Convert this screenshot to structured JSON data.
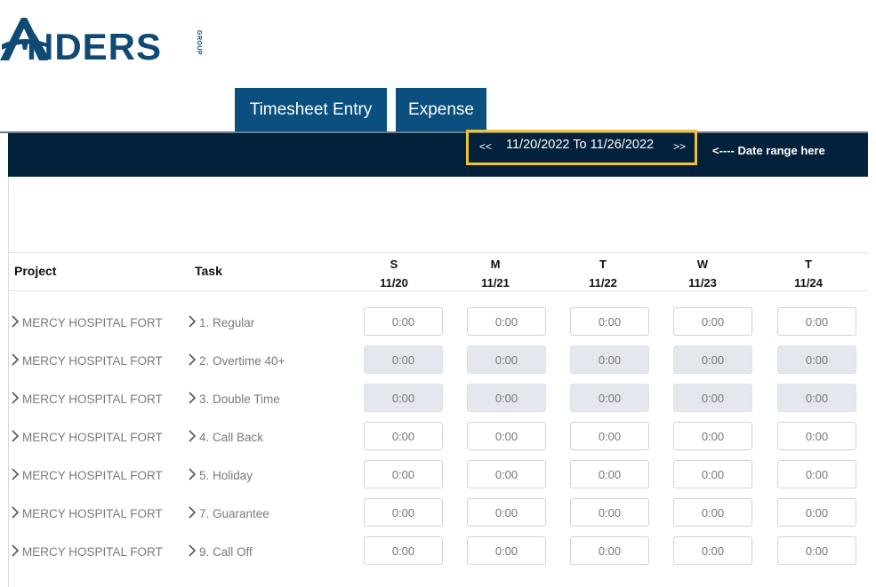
{
  "brand": {
    "name": "NDERS",
    "subtext": "GROUP",
    "color": "#0e4a74"
  },
  "tabs": [
    {
      "label": "Timesheet Entry",
      "active": true
    },
    {
      "label": "Expense",
      "active": false
    }
  ],
  "date_nav": {
    "prev": "<<",
    "range": "11/20/2022 To 11/26/2022",
    "next": ">>",
    "annotation": "<---- Date range here",
    "highlight_color": "#f1c232"
  },
  "grid": {
    "headers": {
      "project": "Project",
      "task": "Task"
    },
    "days": [
      {
        "letter": "S",
        "date": "11/20"
      },
      {
        "letter": "M",
        "date": "11/21"
      },
      {
        "letter": "T",
        "date": "11/22"
      },
      {
        "letter": "W",
        "date": "11/23"
      },
      {
        "letter": "T",
        "date": "11/24"
      }
    ],
    "rows": [
      {
        "project": "MERCY HOSPITAL FORT",
        "task": "1. Regular",
        "editable": true,
        "hours": [
          "0:00",
          "0:00",
          "0:00",
          "0:00",
          "0:00"
        ]
      },
      {
        "project": "MERCY HOSPITAL FORT",
        "task": "2. Overtime 40+",
        "editable": false,
        "hours": [
          "0:00",
          "0:00",
          "0:00",
          "0:00",
          "0:00"
        ]
      },
      {
        "project": "MERCY HOSPITAL FORT",
        "task": "3. Double Time",
        "editable": false,
        "hours": [
          "0:00",
          "0:00",
          "0:00",
          "0:00",
          "0:00"
        ]
      },
      {
        "project": "MERCY HOSPITAL FORT",
        "task": "4. Call Back",
        "editable": true,
        "hours": [
          "0:00",
          "0:00",
          "0:00",
          "0:00",
          "0:00"
        ]
      },
      {
        "project": "MERCY HOSPITAL FORT",
        "task": "5. Holiday",
        "editable": true,
        "hours": [
          "0:00",
          "0:00",
          "0:00",
          "0:00",
          "0:00"
        ]
      },
      {
        "project": "MERCY HOSPITAL FORT",
        "task": "7. Guarantee",
        "editable": true,
        "hours": [
          "0:00",
          "0:00",
          "0:00",
          "0:00",
          "0:00"
        ]
      },
      {
        "project": "MERCY HOSPITAL FORT",
        "task": "9. Call Off",
        "editable": true,
        "hours": [
          "0:00",
          "0:00",
          "0:00",
          "0:00",
          "0:00"
        ]
      }
    ]
  },
  "colors": {
    "tab_bg": "#0b4f7f",
    "band_bg": "#03213a",
    "disabled_cell": "#e4e7ee"
  }
}
